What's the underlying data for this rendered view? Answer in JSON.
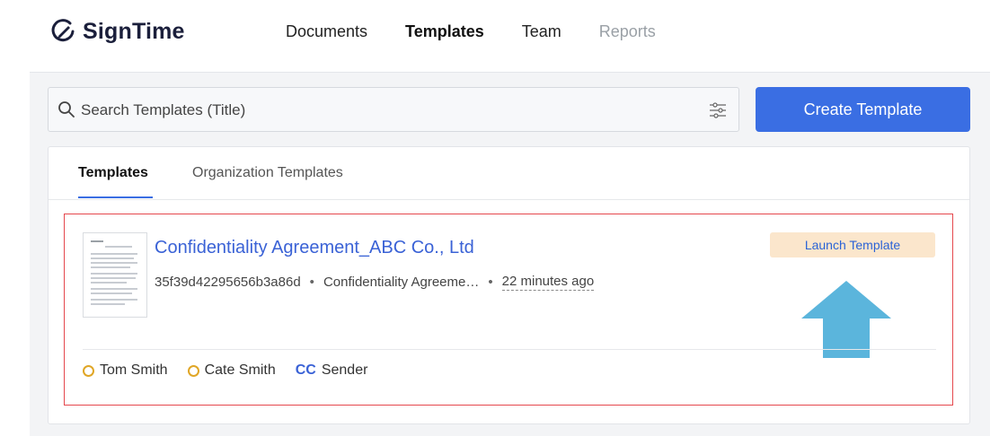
{
  "app": {
    "name": "SignTime"
  },
  "nav": {
    "items": [
      {
        "label": "Documents",
        "state": "normal"
      },
      {
        "label": "Templates",
        "state": "active"
      },
      {
        "label": "Team",
        "state": "normal"
      },
      {
        "label": "Reports",
        "state": "disabled"
      }
    ]
  },
  "search": {
    "placeholder": "Search Templates (Title)",
    "value": ""
  },
  "actions": {
    "create_label": "Create Template"
  },
  "tabs": [
    {
      "label": "Templates",
      "active": true
    },
    {
      "label": "Organization Templates",
      "active": false
    }
  ],
  "template": {
    "title": "Confidentiality Agreement_ABC Co., Ltd",
    "id": "35f39d42295656b3a86d",
    "file": "Confidentiality Agreeme…",
    "separator": "•",
    "time": "22 minutes ago",
    "launch_label": "Launch Template",
    "recipients": [
      {
        "name": "Tom Smith"
      },
      {
        "name": "Cate Smith"
      }
    ],
    "cc": {
      "badge": "CC",
      "name": "Sender"
    }
  },
  "colors": {
    "primary": "#3a6ee3",
    "link": "#3a62d6",
    "launch_bg": "#fbe6cc",
    "highlight_border": "#e5484d",
    "annotation_arrow": "#5bb5dc",
    "recipient_ring": "#e0a626"
  },
  "icons": {
    "logo": "signature-pen-icon",
    "search": "search-icon",
    "filter": "filter-sliders-icon",
    "annotation": "arrow-up-icon"
  }
}
